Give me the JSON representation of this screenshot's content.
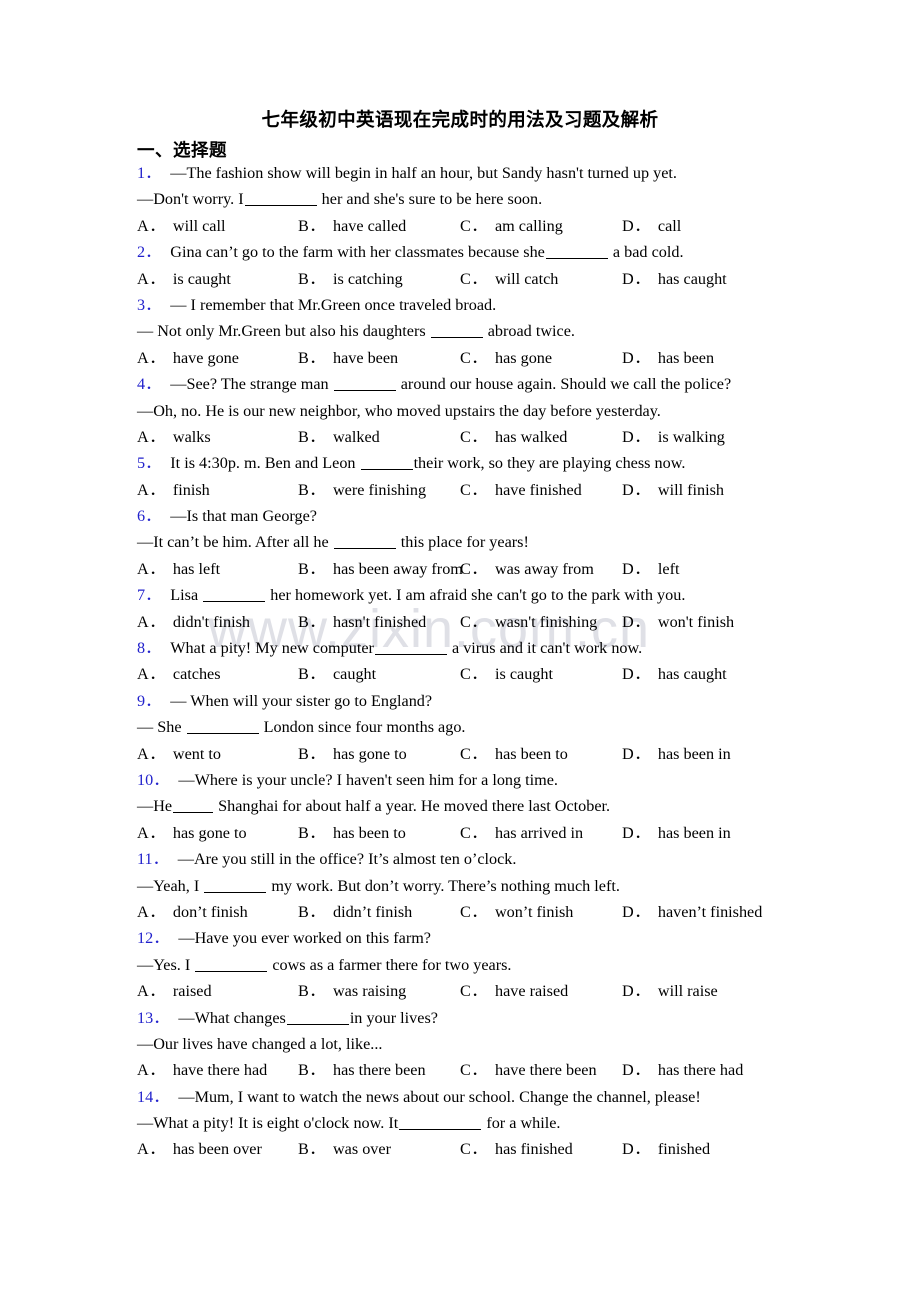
{
  "document": {
    "title": "七年级初中英语现在完成时的用法及习题及解析",
    "section_heading": "一、选择题",
    "watermark": "www.zixin.com.cn",
    "accent_color": "#2222cc",
    "watermark_color": "#dfe0e6"
  },
  "questions": [
    {
      "number": "1．",
      "stem": "—The fashion show will begin in half an hour, but Sandy hasn't turned up yet.",
      "stem2_pre": "—Don't worry. I",
      "stem2_post": " her and she's sure to be here soon.",
      "blank_size": "b-lg",
      "options": [
        {
          "label": "A．",
          "text": "will call"
        },
        {
          "label": "B．",
          "text": "have called"
        },
        {
          "label": "C．",
          "text": "am calling"
        },
        {
          "label": "D．",
          "text": "call"
        }
      ]
    },
    {
      "number": "2．",
      "stem_pre": "Gina can’t go to the farm with her classmates because she",
      "stem_post": " a bad cold.",
      "blank_size": "b-md",
      "options": [
        {
          "label": "A．",
          "text": "is caught"
        },
        {
          "label": "B．",
          "text": "is catching"
        },
        {
          "label": "C．",
          "text": "will catch"
        },
        {
          "label": "D．",
          "text": "has caught"
        }
      ]
    },
    {
      "number": "3．",
      "stem": "— I remember that Mr.Green once traveled broad.",
      "stem2_pre": "— Not only Mr.Green but also his daughters ",
      "stem2_post": " abroad twice.",
      "blank_size": "b-sm",
      "options": [
        {
          "label": "A．",
          "text": "have gone"
        },
        {
          "label": "B．",
          "text": "have been"
        },
        {
          "label": "C．",
          "text": "has gone"
        },
        {
          "label": "D．",
          "text": "has been"
        }
      ]
    },
    {
      "number": "4．",
      "stem_pre": "—See? The strange man ",
      "stem_post": " around our house again. Should we call the police?",
      "blank_size": "b-md",
      "stem2": "—Oh, no. He is our new neighbor, who moved upstairs the day before yesterday.",
      "options": [
        {
          "label": "A．",
          "text": "walks"
        },
        {
          "label": "B．",
          "text": "walked"
        },
        {
          "label": "C．",
          "text": "has walked"
        },
        {
          "label": "D．",
          "text": "is walking"
        }
      ]
    },
    {
      "number": "5．",
      "stem_pre": "It is 4:30p. m. Ben and Leon ",
      "stem_post": "their work, so they are playing chess now.",
      "blank_size": "b-sm",
      "options": [
        {
          "label": "A．",
          "text": "finish"
        },
        {
          "label": "B．",
          "text": "were finishing"
        },
        {
          "label": "C．",
          "text": "have finished"
        },
        {
          "label": "D．",
          "text": "will finish"
        }
      ]
    },
    {
      "number": "6．",
      "stem": "—Is that man George?",
      "stem2_pre": "—It can’t be him. After all he ",
      "stem2_post": " this place for years!",
      "blank_size": "b-md",
      "options": [
        {
          "label": "A．",
          "text": "has left"
        },
        {
          "label": "B．",
          "text": "has been away from"
        },
        {
          "label": "C．",
          "text": "was away from"
        },
        {
          "label": "D．",
          "text": "left"
        }
      ],
      "option_layout": "tight"
    },
    {
      "number": "7．",
      "stem_pre": "Lisa ",
      "stem_post": " her homework yet. I am afraid she can't go to the park with you.",
      "blank_size": "b-md",
      "options": [
        {
          "label": "A．",
          "text": "didn't finish"
        },
        {
          "label": "B．",
          "text": "hasn't finished"
        },
        {
          "label": "C．",
          "text": "wasn't finishing"
        },
        {
          "label": "D．",
          "text": "won't finish"
        }
      ]
    },
    {
      "number": "8．",
      "stem_pre": "What a pity! My new computer",
      "stem_post": " a virus and it can't work now.",
      "blank_size": "b-lg",
      "options": [
        {
          "label": "A．",
          "text": "catches"
        },
        {
          "label": "B．",
          "text": "caught"
        },
        {
          "label": "C．",
          "text": "is caught"
        },
        {
          "label": "D．",
          "text": "has caught"
        }
      ]
    },
    {
      "number": "9．",
      "stem": "— When will your sister go to England?",
      "stem2_pre": "— She ",
      "stem2_post": " London since four months ago.",
      "blank_size": "b-lg",
      "options": [
        {
          "label": "A．",
          "text": "went to"
        },
        {
          "label": "B．",
          "text": "has gone to"
        },
        {
          "label": "C．",
          "text": "has been to"
        },
        {
          "label": "D．",
          "text": "has been in"
        }
      ]
    },
    {
      "number": "10．",
      "stem": "—Where is your uncle? I haven't seen him for a long time.",
      "stem2_pre": "—He",
      "stem2_post": " Shanghai for about half a year. He moved there last October.",
      "blank_size": "b-xs",
      "options": [
        {
          "label": "A．",
          "text": "has gone to"
        },
        {
          "label": "B．",
          "text": "has been to"
        },
        {
          "label": "C．",
          "text": "has arrived in"
        },
        {
          "label": "D．",
          "text": "has been in"
        }
      ]
    },
    {
      "number": "11．",
      "stem": "—Are you still in the office? It’s almost ten o’clock.",
      "stem2_pre": "—Yeah, I ",
      "stem2_post": " my work. But don’t worry. There’s nothing much left.",
      "blank_size": "b-md",
      "options": [
        {
          "label": "A．",
          "text": "don’t finish"
        },
        {
          "label": "B．",
          "text": "didn’t finish"
        },
        {
          "label": "C．",
          "text": "won’t finish"
        },
        {
          "label": "D．",
          "text": "haven’t finished"
        }
      ]
    },
    {
      "number": "12．",
      "stem": "—Have you ever worked on this farm?",
      "stem2_pre": "—Yes. I ",
      "stem2_post": " cows as a farmer there for two years.",
      "blank_size": "b-lg",
      "options": [
        {
          "label": "A．",
          "text": "raised"
        },
        {
          "label": "B．",
          "text": "was raising"
        },
        {
          "label": "C．",
          "text": "have raised"
        },
        {
          "label": "D．",
          "text": "will raise"
        }
      ]
    },
    {
      "number": "13．",
      "stem_pre": "—What changes",
      "stem_post": "in your lives?",
      "blank_size": "b-md",
      "stem2": "—Our lives have changed a lot, like...",
      "options": [
        {
          "label": "A．",
          "text": "have there had"
        },
        {
          "label": "B．",
          "text": "has there been"
        },
        {
          "label": "C．",
          "text": "have there been"
        },
        {
          "label": "D．",
          "text": "has there had"
        }
      ]
    },
    {
      "number": "14．",
      "stem": "—Mum, I want to watch the news about our school. Change the channel, please!",
      "stem2_pre": "—What a pity! It is eight o'clock now. It",
      "stem2_post": " for a while.",
      "blank_size": "b-xl",
      "options": [
        {
          "label": "A．",
          "text": "has been over"
        },
        {
          "label": "B．",
          "text": "was over"
        },
        {
          "label": "C．",
          "text": "has finished"
        },
        {
          "label": "D．",
          "text": "finished"
        }
      ]
    }
  ]
}
